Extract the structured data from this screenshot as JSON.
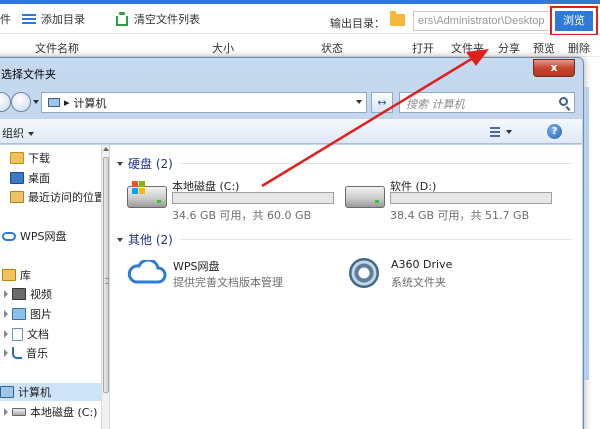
{
  "toolbar": {
    "cut_label": "件",
    "add_dir": "添加目录",
    "clear_list": "清空文件列表",
    "output_label": "输出目录：",
    "output_path": "ers\\Administrator\\Desktop",
    "browse": "浏览"
  },
  "columns": {
    "name": "文件名称",
    "size": "大小",
    "status": "状态",
    "open": "打开",
    "folder": "文件夹",
    "share": "分享",
    "preview": "预览",
    "delete": "删除"
  },
  "dialog": {
    "title": "选择文件夹",
    "close": "x",
    "address": "计算机",
    "address_sep": "▸",
    "search_placeholder": "搜索 计算机",
    "refresh": "↔",
    "organize": "组织",
    "help": "?"
  },
  "nav": {
    "items": [
      {
        "label": "下载"
      },
      {
        "label": "桌面"
      },
      {
        "label": "最近访问的位置"
      },
      {
        "label": "WPS网盘"
      },
      {
        "label": "库"
      },
      {
        "label": "视频"
      },
      {
        "label": "图片"
      },
      {
        "label": "文档"
      },
      {
        "label": "音乐"
      },
      {
        "label": "计算机"
      },
      {
        "label": "本地磁盘 (C:)"
      }
    ]
  },
  "groups": {
    "hdd": "硬盘 (2)",
    "other": "其他 (2)"
  },
  "drives": [
    {
      "name": "本地磁盘 (C:)",
      "info": "34.6 GB 可用，共 60.0 GB",
      "used_fraction": 0.42
    },
    {
      "name": "软件 (D:)",
      "info": "38.4 GB 可用，共 51.7 GB",
      "used_fraction": 0.26
    }
  ],
  "others": [
    {
      "name": "WPS网盘",
      "desc": "提供完善文档版本管理"
    },
    {
      "name": "A360 Drive",
      "desc": "系统文件夹"
    }
  ],
  "colors": {
    "accent": "#2d7bd6",
    "highlight_box": "#e0201d",
    "arrow": "#e0201d"
  }
}
